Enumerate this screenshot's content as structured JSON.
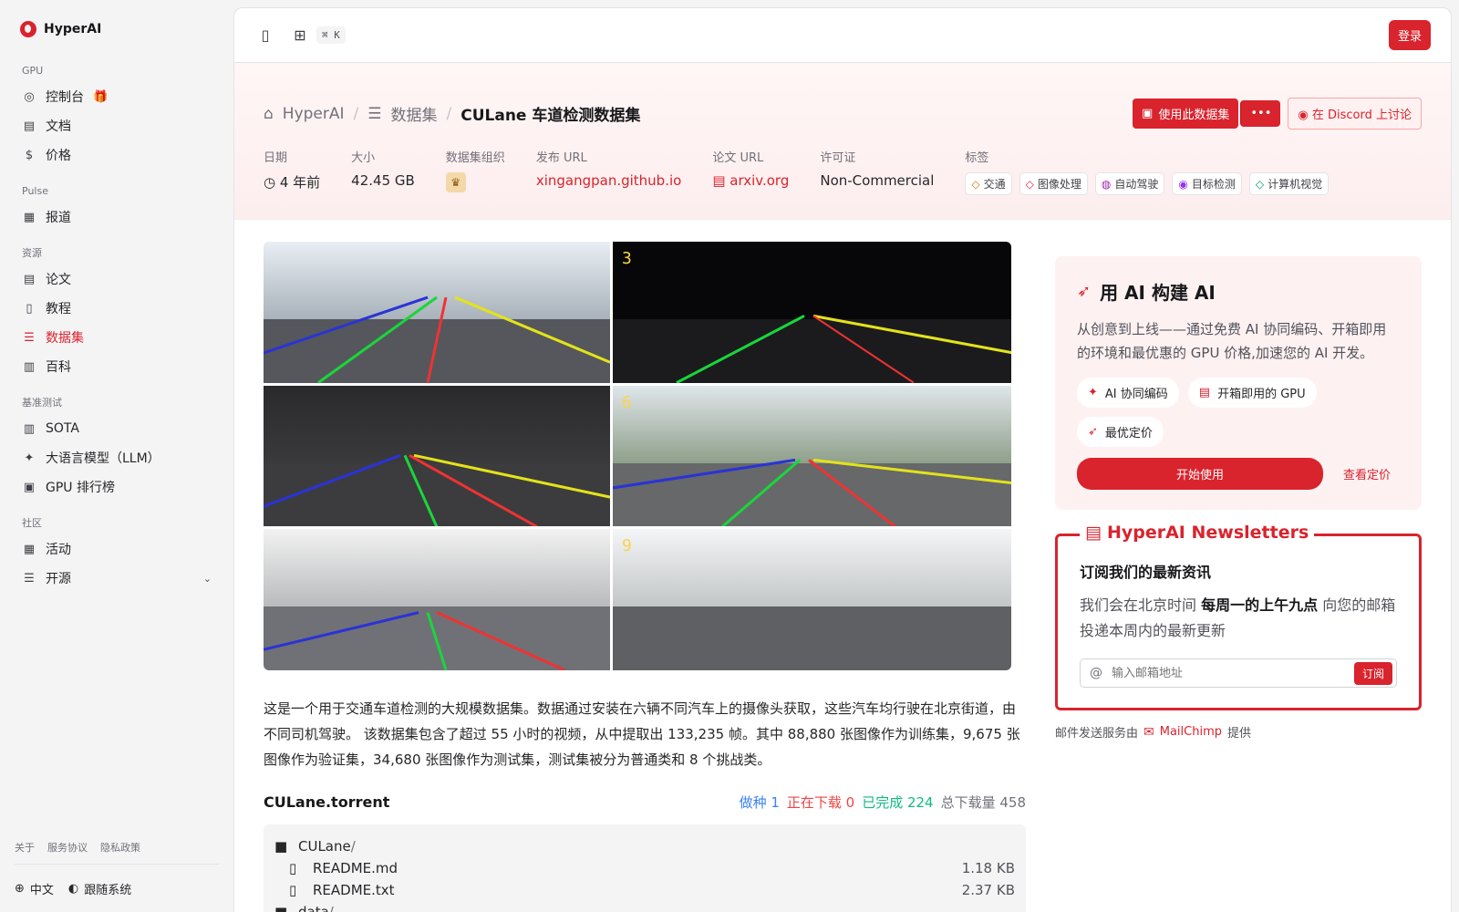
{
  "brand": {
    "name": "HyperAI"
  },
  "sidebar": {
    "sections": [
      {
        "title": "GPU",
        "items": [
          {
            "label": "控制台",
            "icon": "dashboard-icon",
            "gift": true
          },
          {
            "label": "文档",
            "icon": "doc-icon"
          },
          {
            "label": "价格",
            "icon": "price-icon"
          }
        ]
      },
      {
        "title": "Pulse",
        "items": [
          {
            "label": "报道",
            "icon": "news-icon"
          }
        ]
      },
      {
        "title": "资源",
        "items": [
          {
            "label": "论文",
            "icon": "paper-icon"
          },
          {
            "label": "教程",
            "icon": "tutorial-icon"
          },
          {
            "label": "数据集",
            "icon": "database-icon",
            "active": true
          },
          {
            "label": "百科",
            "icon": "wiki-icon"
          }
        ]
      },
      {
        "title": "基准测试",
        "items": [
          {
            "label": "SOTA",
            "icon": "chart-icon"
          },
          {
            "label": "大语言模型（LLM）",
            "icon": "sparkle-icon"
          },
          {
            "label": "GPU 排行榜",
            "icon": "chip-icon"
          }
        ]
      },
      {
        "title": "社区",
        "items": [
          {
            "label": "活动",
            "icon": "calendar-icon"
          },
          {
            "label": "开源",
            "icon": "list-icon",
            "expand": true
          }
        ]
      }
    ],
    "footer_links": [
      "关于",
      "服务协议",
      "隐私政策"
    ],
    "language": "中文",
    "theme": "跟随系统"
  },
  "topbar": {
    "shortcut": "⌘ K",
    "login": "登录"
  },
  "breadcrumb": {
    "home": "HyperAI",
    "section": "数据集",
    "current": "CULane 车道检测数据集"
  },
  "actions": {
    "use_dataset": "使用此数据集",
    "more": "•••",
    "discord": "在 Discord 上讨论"
  },
  "meta": {
    "date_label": "日期",
    "date_value": "4 年前",
    "size_label": "大小",
    "size_value": "42.45 GB",
    "org_label": "数据集组织",
    "publish_label": "发布 URL",
    "publish_value": "xingangpan.github.io",
    "paper_label": "论文 URL",
    "paper_value": "arxiv.org",
    "license_label": "许可证",
    "license_value": "Non-Commercial",
    "tags_label": "标签",
    "tags": [
      "交通",
      "图像处理",
      "自动驾驶",
      "目标检测",
      "计算机视觉"
    ]
  },
  "figure_numbers": [
    "3",
    "6",
    "9"
  ],
  "description": "这是一个用于交通车道检测的大规模数据集。数据通过安装在六辆不同汽车上的摄像头获取，这些汽车均行驶在北京街道，由不同司机驾驶。 该数据集包含了超过 55 小时的视频，从中提取出 133,235 帧。其中 88,880 张图像作为训练集，9,675 张图像作为验证集，34,680 张图像作为测试集，测试集被分为普通类和 8 个挑战类。",
  "torrent": {
    "name": "CULane.torrent",
    "seeding": "做种 1",
    "downloading": "正在下载 0",
    "completed": "已完成 224",
    "total": "总下载量 458",
    "files": [
      {
        "name": "CULane",
        "suffix": "/",
        "type": "folder",
        "size": ""
      },
      {
        "name": "README.md",
        "type": "file",
        "size": "1.18 KB"
      },
      {
        "name": "README.txt",
        "type": "file",
        "size": "2.37 KB"
      },
      {
        "name": "data",
        "suffix": "/",
        "type": "folder",
        "size": ""
      }
    ]
  },
  "promo": {
    "title": "用 AI 构建 AI",
    "text": "从创意到上线——通过免费 AI 协同编码、开箱即用的环境和最优惠的 GPU 价格,加速您的 AI 开发。",
    "chips": [
      "AI 协同编码",
      "开箱即用的 GPU",
      "最优定价"
    ],
    "start": "开始使用",
    "pricing": "查看定价"
  },
  "newsletter": {
    "legend": "HyperAI Newsletters",
    "title": "订阅我们的最新资讯",
    "text_before": "我们会在北京时间",
    "text_bold": "每周一的上午九点",
    "text_after": "向您的邮箱投递本周内的最新更新",
    "placeholder": "输入邮箱地址",
    "button": "订阅",
    "mail_prefix": "邮件发送服务由",
    "mail_brand": "MailChimp",
    "mail_suffix": "提供"
  },
  "colors": {
    "accent": "#d9232d"
  }
}
